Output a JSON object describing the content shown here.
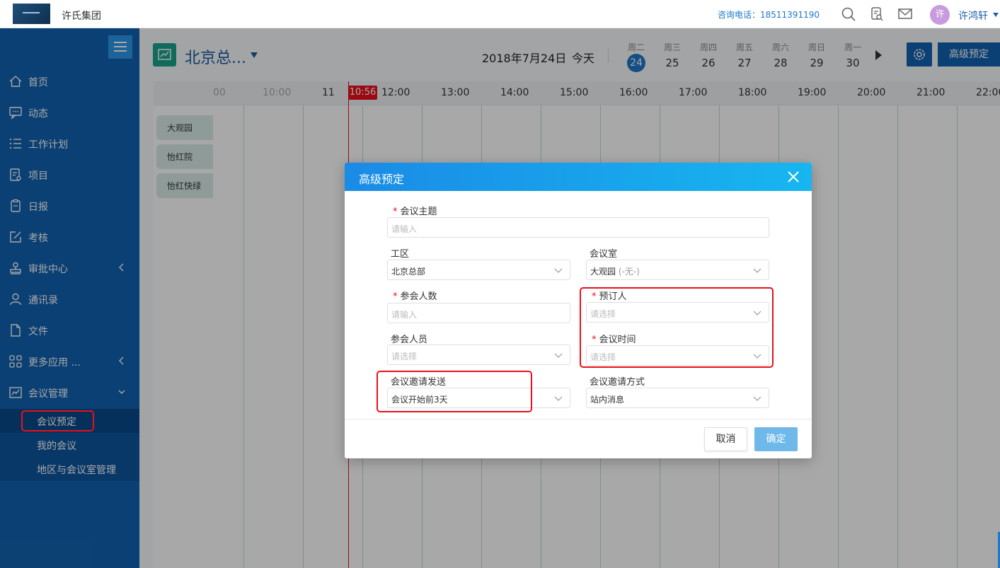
{
  "topbar": {
    "company": "许氏集团",
    "hotline_label": "咨询电话：18511391190",
    "avatar_char": "许",
    "username": "许鸿轩"
  },
  "sidebar": {
    "items": [
      {
        "label": "首页",
        "icon": "home-icon"
      },
      {
        "label": "动态",
        "icon": "chat-icon"
      },
      {
        "label": "工作计划",
        "icon": "list-icon"
      },
      {
        "label": "项目",
        "icon": "project-icon"
      },
      {
        "label": "日报",
        "icon": "daily-report-icon"
      },
      {
        "label": "考核",
        "icon": "edit-icon"
      },
      {
        "label": "审批中心",
        "icon": "approval-icon"
      },
      {
        "label": "通讯录",
        "icon": "contacts-icon"
      },
      {
        "label": "文件",
        "icon": "file-icon"
      },
      {
        "label": "更多应用 ...",
        "icon": "apps-icon"
      },
      {
        "label": "会议管理",
        "icon": "meeting-icon"
      }
    ],
    "sub_items": [
      {
        "label": "会议预定"
      },
      {
        "label": "我的会议"
      },
      {
        "label": "地区与会议室管理"
      }
    ]
  },
  "header": {
    "location": "北京总...",
    "date": "2018年7月24日",
    "today": "今天",
    "week": [
      {
        "name": "周二",
        "num": "24"
      },
      {
        "name": "周三",
        "num": "25"
      },
      {
        "name": "周四",
        "num": "26"
      },
      {
        "name": "周五",
        "num": "27"
      },
      {
        "name": "周六",
        "num": "28"
      },
      {
        "name": "周日",
        "num": "29"
      },
      {
        "name": "周一",
        "num": "30"
      }
    ],
    "advanced_button": "高级预定"
  },
  "timeline": {
    "hours": [
      "00",
      "10:00",
      "11",
      "12:00",
      "13:00",
      "14:00",
      "15:00",
      "16:00",
      "17:00",
      "18:00",
      "19:00",
      "20:00",
      "21:00",
      "22:00"
    ],
    "now": "10:56",
    "rooms": [
      "大观园",
      "怡红院",
      "怡红快绿"
    ]
  },
  "modal": {
    "title": "高级预定",
    "fields": {
      "subject_label": "会议主题",
      "subject_placeholder": "请输入",
      "area_label": "工区",
      "area_value": "北京总部",
      "room_label": "会议室",
      "room_value": "大观园",
      "room_sub": "(-无-)",
      "count_label": "参会人数",
      "count_placeholder": "请输入",
      "booker_label": "预订人",
      "booker_placeholder": "请选择",
      "attendees_label": "参会人员",
      "attendees_placeholder": "请选择",
      "time_label": "会议时间",
      "time_placeholder": "请选择",
      "invite_send_label": "会议邀请发送",
      "invite_send_value": "会议开始前3天",
      "invite_method_label": "会议邀请方式",
      "invite_method_value": "站内消息"
    },
    "cancel": "取消",
    "ok": "确定"
  },
  "colors": {
    "sidebar_bg": "#1262b0",
    "accent": "#1e78c8",
    "highlight_red": "#e8101a",
    "modal_header": "#1a8be6"
  }
}
